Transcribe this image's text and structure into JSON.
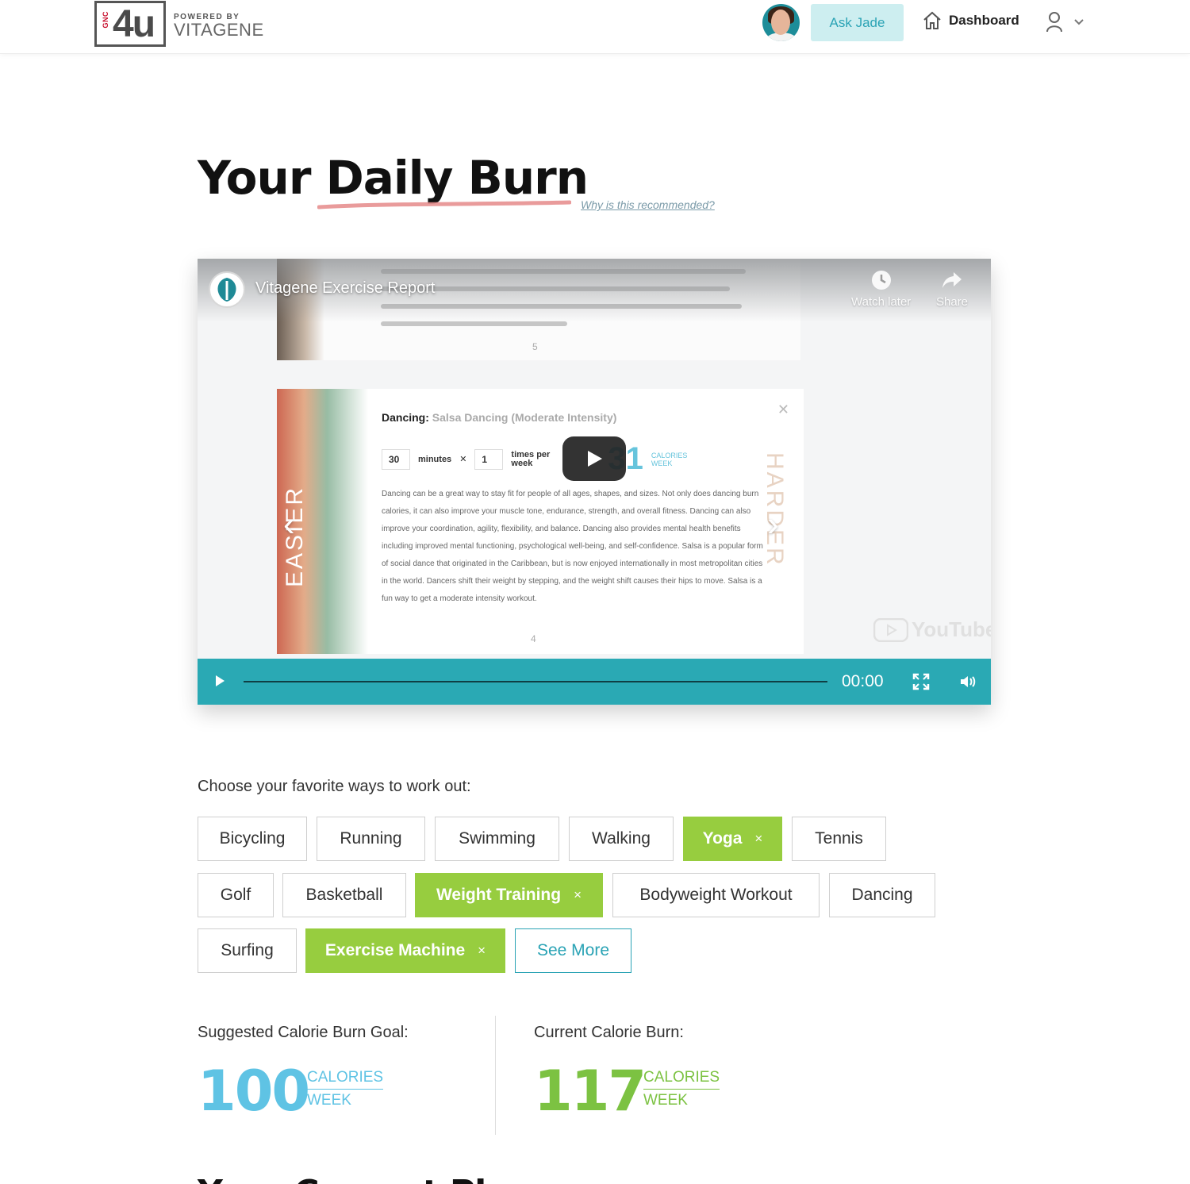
{
  "header": {
    "logo": {
      "brand": "4u",
      "badge": "GNC",
      "powered_by": "POWERED BY",
      "company": "VITAGENE"
    },
    "ask_button": "Ask Jade",
    "dashboard_label": "Dashboard"
  },
  "page": {
    "title": "Your Daily Burn",
    "why_link": "Why is this recommended?",
    "next_section_title_partial": "Your Current Pl"
  },
  "video": {
    "title": "Vitagene Exercise Report",
    "watch_later": "Watch later",
    "share": "Share",
    "time": "00:00",
    "youtube_label": "YouTube",
    "progress": 0,
    "slide": {
      "heading": "Dancing:",
      "subheading": "Salsa Dancing (Moderate Intensity)",
      "minutes_value": "30",
      "minutes_label": "minutes",
      "times_value": "1",
      "times_label": "times per week",
      "calories_partial": "31",
      "calories_unit_1": "CALORIES",
      "calories_unit_2": "WEEK",
      "easier_label": "EASIER",
      "harder_label": "HARDER",
      "body": "Dancing can be a great way to stay fit for people of all ages, shapes, and sizes. Not only does dancing burn calories, it can also improve your muscle tone, endurance, strength, and overall fitness. Dancing can also improve your coordination, agility, flexibility, and balance. Dancing also provides mental health benefits including improved mental functioning, psychological well-being, and self-confidence. Salsa is a popular form of social dance that originated in the Caribbean, but is now enjoyed internationally in most metropolitan cities in the world. Dancers shift their weight by stepping, and the weight shift causes their hips to move. Salsa is a fun way to get a moderate intensity workout.",
      "top_snippet": "and arthritis. Taking a bike ride with some friends on the weekend, or even biking to and from work during the summertime can reap some amazing benefits for your health. Mountain biking involves riding bikes off-road, often over rough terrain. For a very high intensity workout, try mountain biking uphill.",
      "page_top": "5",
      "page_bottom": "4"
    }
  },
  "workouts": {
    "label": "Choose your favorite ways to work out:",
    "chips": [
      {
        "label": "Bicycling",
        "selected": false
      },
      {
        "label": "Running",
        "selected": false
      },
      {
        "label": "Swimming",
        "selected": false
      },
      {
        "label": "Walking",
        "selected": false
      },
      {
        "label": "Yoga",
        "selected": true
      },
      {
        "label": "Tennis",
        "selected": false
      },
      {
        "label": "Golf",
        "selected": false
      },
      {
        "label": "Basketball",
        "selected": false
      },
      {
        "label": "Weight Training",
        "selected": true
      },
      {
        "label": "Bodyweight Workout",
        "selected": false
      },
      {
        "label": "Dancing",
        "selected": false
      },
      {
        "label": "Surfing",
        "selected": false
      },
      {
        "label": "Exercise Machine",
        "selected": true
      }
    ],
    "remove_symbol": "×",
    "see_more": "See More"
  },
  "calories": {
    "goal": {
      "label": "Suggested Calorie Burn Goal:",
      "value": "100",
      "unit_1": "CALORIES",
      "unit_2": "WEEK",
      "color": "#5fc3e4"
    },
    "current": {
      "label": "Current Calorie Burn:",
      "value": "117",
      "unit_1": "CALORIES",
      "unit_2": "WEEK",
      "color": "#7cc242"
    }
  },
  "colors": {
    "accent_teal": "#2aa9b4",
    "selected_green": "#97cd3f",
    "ask_bg": "#cdeef0",
    "underline_red": "#e58a8a"
  }
}
